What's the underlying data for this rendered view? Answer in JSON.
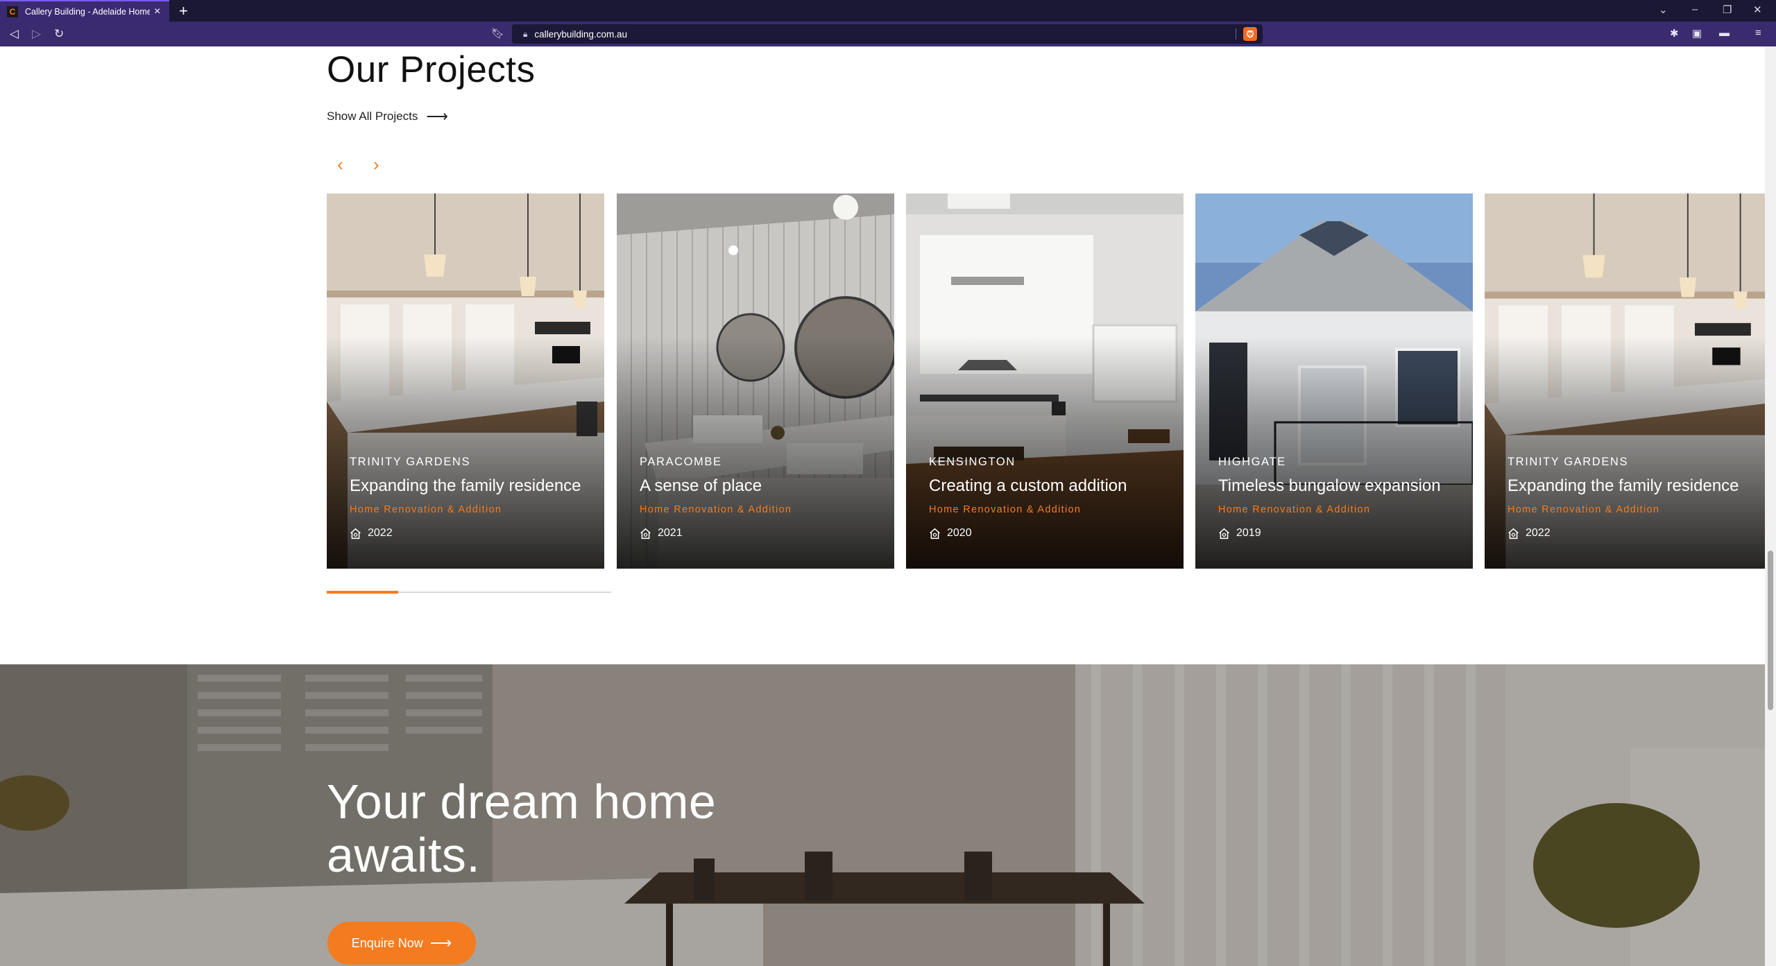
{
  "browser": {
    "tab_title": "Callery Building - Adelaide Home",
    "tab_favicon": "C",
    "url": "callerybuilding.com.au"
  },
  "projects": {
    "heading": "Our Projects",
    "show_all_label": "Show All Projects",
    "cards": [
      {
        "location": "TRINITY GARDENS",
        "title": "Expanding the family residence",
        "category": "Home Renovation & Addition",
        "year": "2022"
      },
      {
        "location": "PARACOMBE",
        "title": "A sense of place",
        "category": "Home Renovation & Addition",
        "year": "2021"
      },
      {
        "location": "KENSINGTON",
        "title": "Creating a custom addition",
        "category": "Home Renovation & Addition",
        "year": "2020"
      },
      {
        "location": "HIGHGATE",
        "title": "Timeless bungalow expansion",
        "category": "Home Renovation & Addition",
        "year": "2019"
      },
      {
        "location": "TRINITY GARDENS",
        "title": "Expanding the family residence",
        "category": "Home Renovation & Addition",
        "year": "2022"
      }
    ],
    "slider_progress": 0.25
  },
  "banner": {
    "heading": "Your dream home awaits.",
    "cta_label": "Enquire Now"
  },
  "colors": {
    "accent": "#f47c20",
    "browser_bar": "#3a2a6e",
    "tab_strip": "#1b1833"
  }
}
